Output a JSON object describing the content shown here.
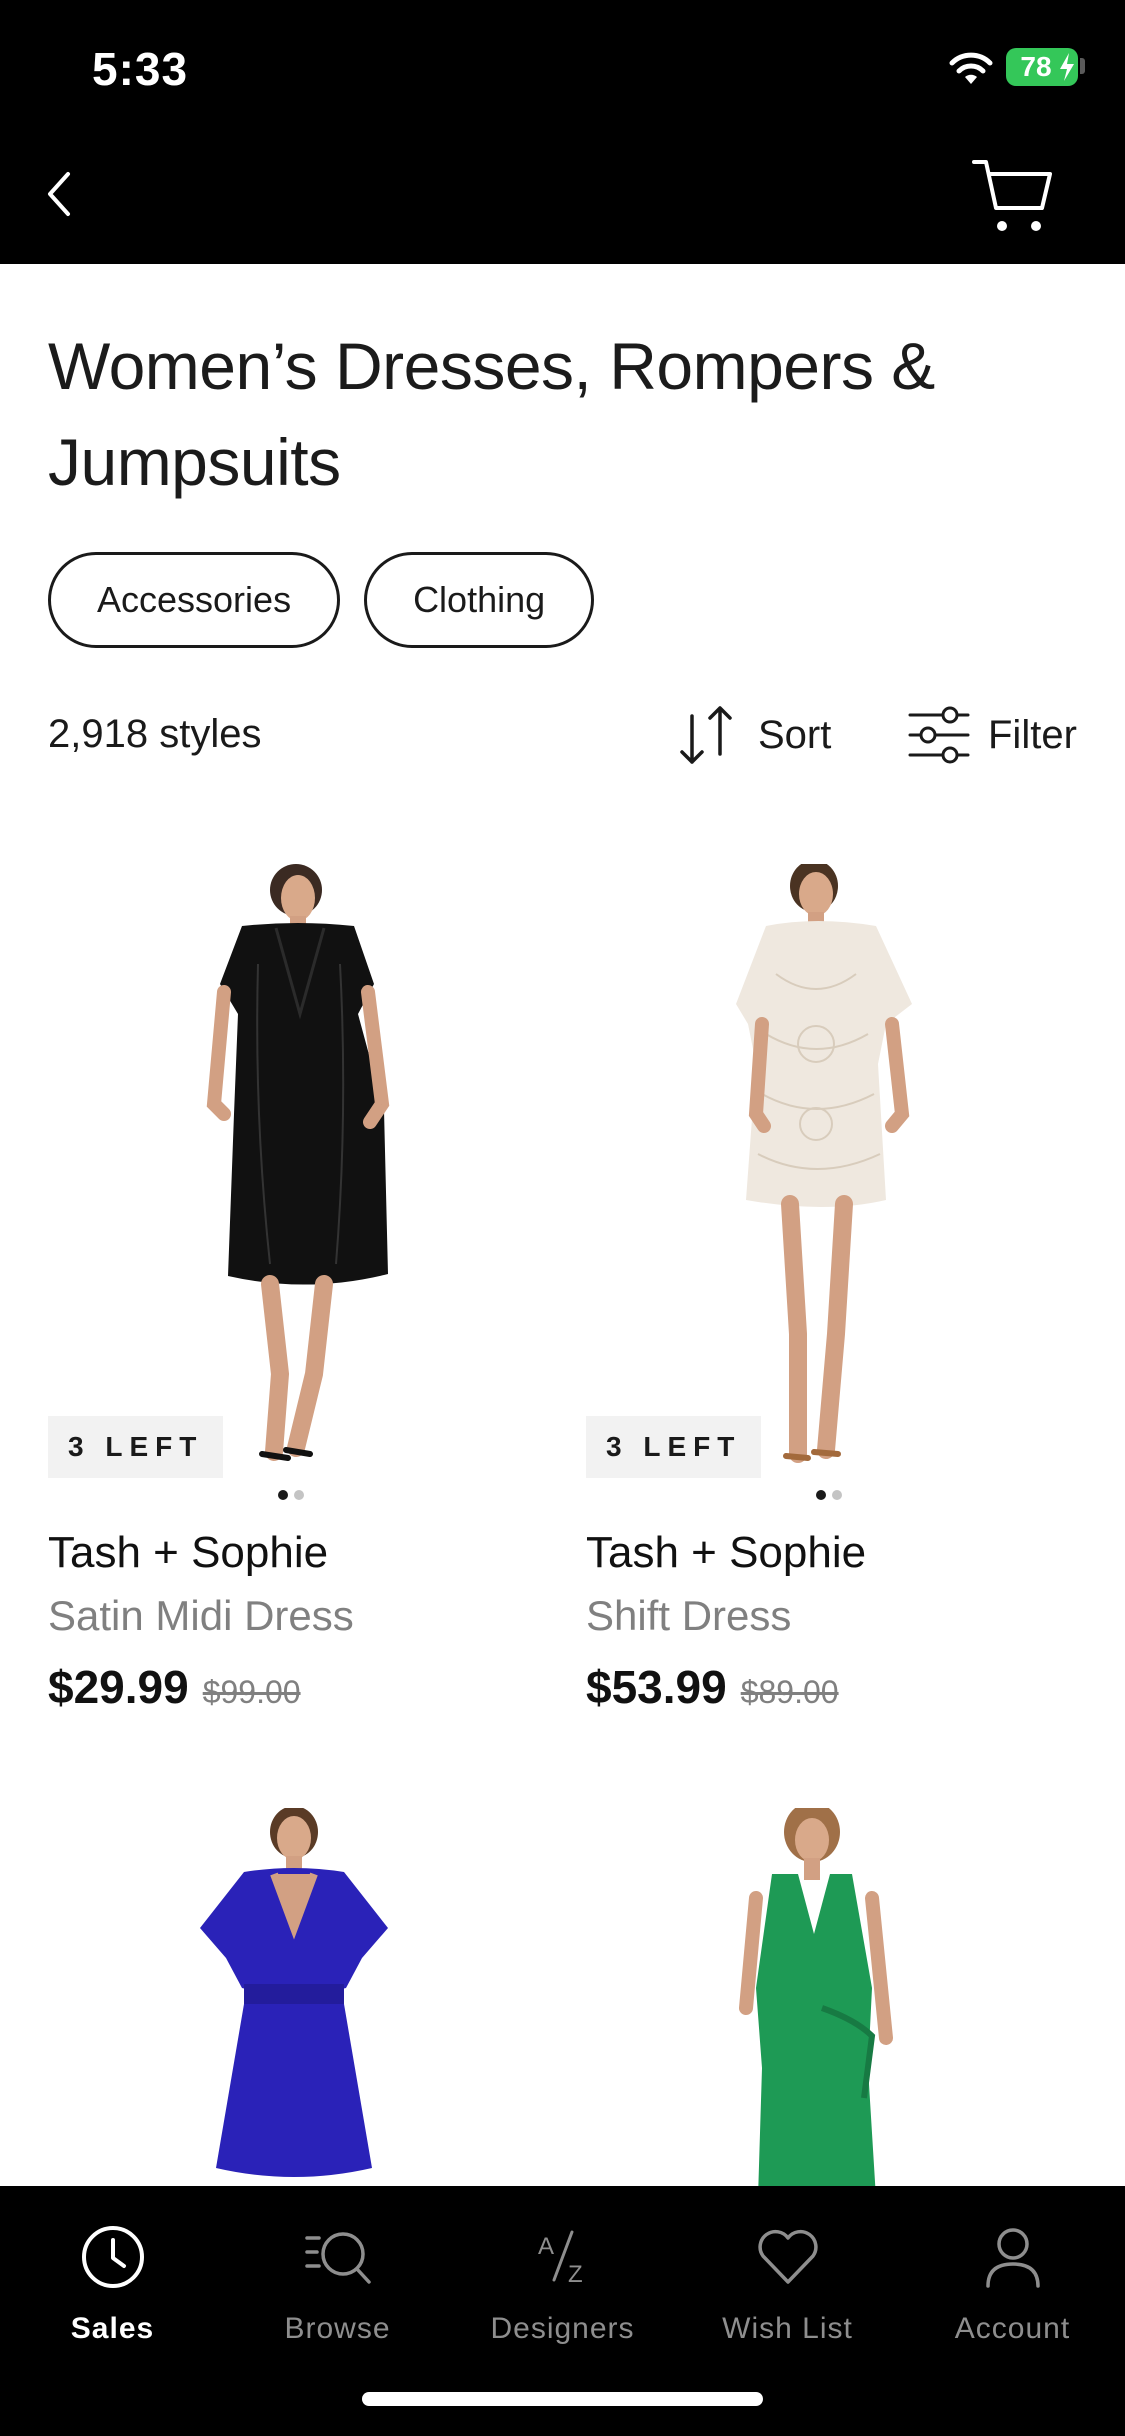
{
  "status_bar": {
    "time": "5:33",
    "battery": "78"
  },
  "nav": {
    "back_icon": "chevron-left-icon",
    "cart_icon": "cart-icon"
  },
  "header": {
    "title": "Women’s Dresses, Rompers & Jumpsuits",
    "chips": [
      "Accessories",
      "Clothing"
    ]
  },
  "toolbar": {
    "count": "2,918 styles",
    "sort_label": "Sort",
    "filter_label": "Filter"
  },
  "products": [
    {
      "stock": "3 LEFT",
      "brand": "Tash + Sophie",
      "name": "Satin Midi Dress",
      "price": "$29.99",
      "original_price": "$99.00",
      "dress_color": "#111111"
    },
    {
      "stock": "3 LEFT",
      "brand": "Tash + Sophie",
      "name": "Shift Dress",
      "price": "$53.99",
      "original_price": "$89.00",
      "dress_color": "#efe8df"
    },
    {
      "dress_color": "#2a22b8"
    },
    {
      "dress_color": "#1e9a55"
    }
  ],
  "tabs": [
    {
      "label": "Sales",
      "icon": "clock-icon",
      "active": true
    },
    {
      "label": "Browse",
      "icon": "search-icon",
      "active": false
    },
    {
      "label": "Designers",
      "icon": "az-icon",
      "active": false
    },
    {
      "label": "Wish List",
      "icon": "heart-icon",
      "active": false
    },
    {
      "label": "Account",
      "icon": "person-icon",
      "active": false
    }
  ]
}
